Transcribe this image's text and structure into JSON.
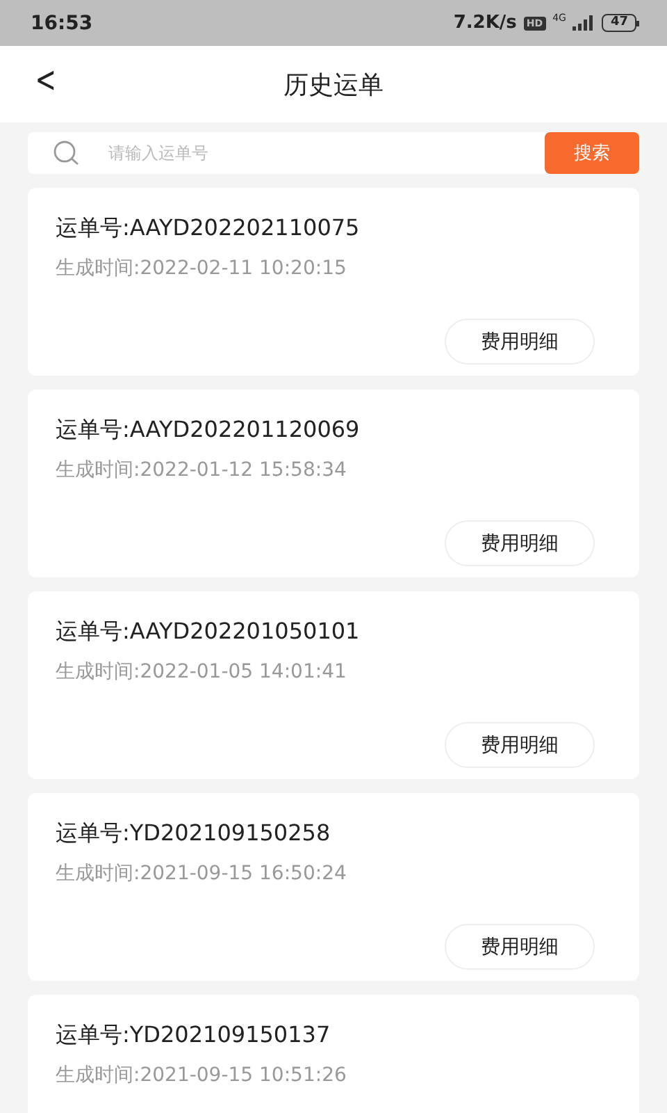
{
  "status_bar": {
    "time": "16:53",
    "speed": "7.2K/s",
    "hd": "HD",
    "network": "4G",
    "battery": "47"
  },
  "header": {
    "back": "<",
    "title": "历史运单"
  },
  "search": {
    "placeholder": "请输入运单号",
    "button": "搜索"
  },
  "orders": [
    {
      "number": "运单号:AAYD202202110075",
      "created": "生成时间:2022-02-11 10:20:15",
      "button": "费用明细"
    },
    {
      "number": "运单号:AAYD202201120069",
      "created": "生成时间:2022-01-12 15:58:34",
      "button": "费用明细"
    },
    {
      "number": "运单号:AAYD202201050101",
      "created": "生成时间:2022-01-05 14:01:41",
      "button": "费用明细"
    },
    {
      "number": "运单号:YD202109150258",
      "created": "生成时间:2021-09-15 16:50:24",
      "button": "费用明细"
    },
    {
      "number": "运单号:YD202109150137",
      "created": "生成时间:2021-09-15 10:51:26"
    }
  ]
}
